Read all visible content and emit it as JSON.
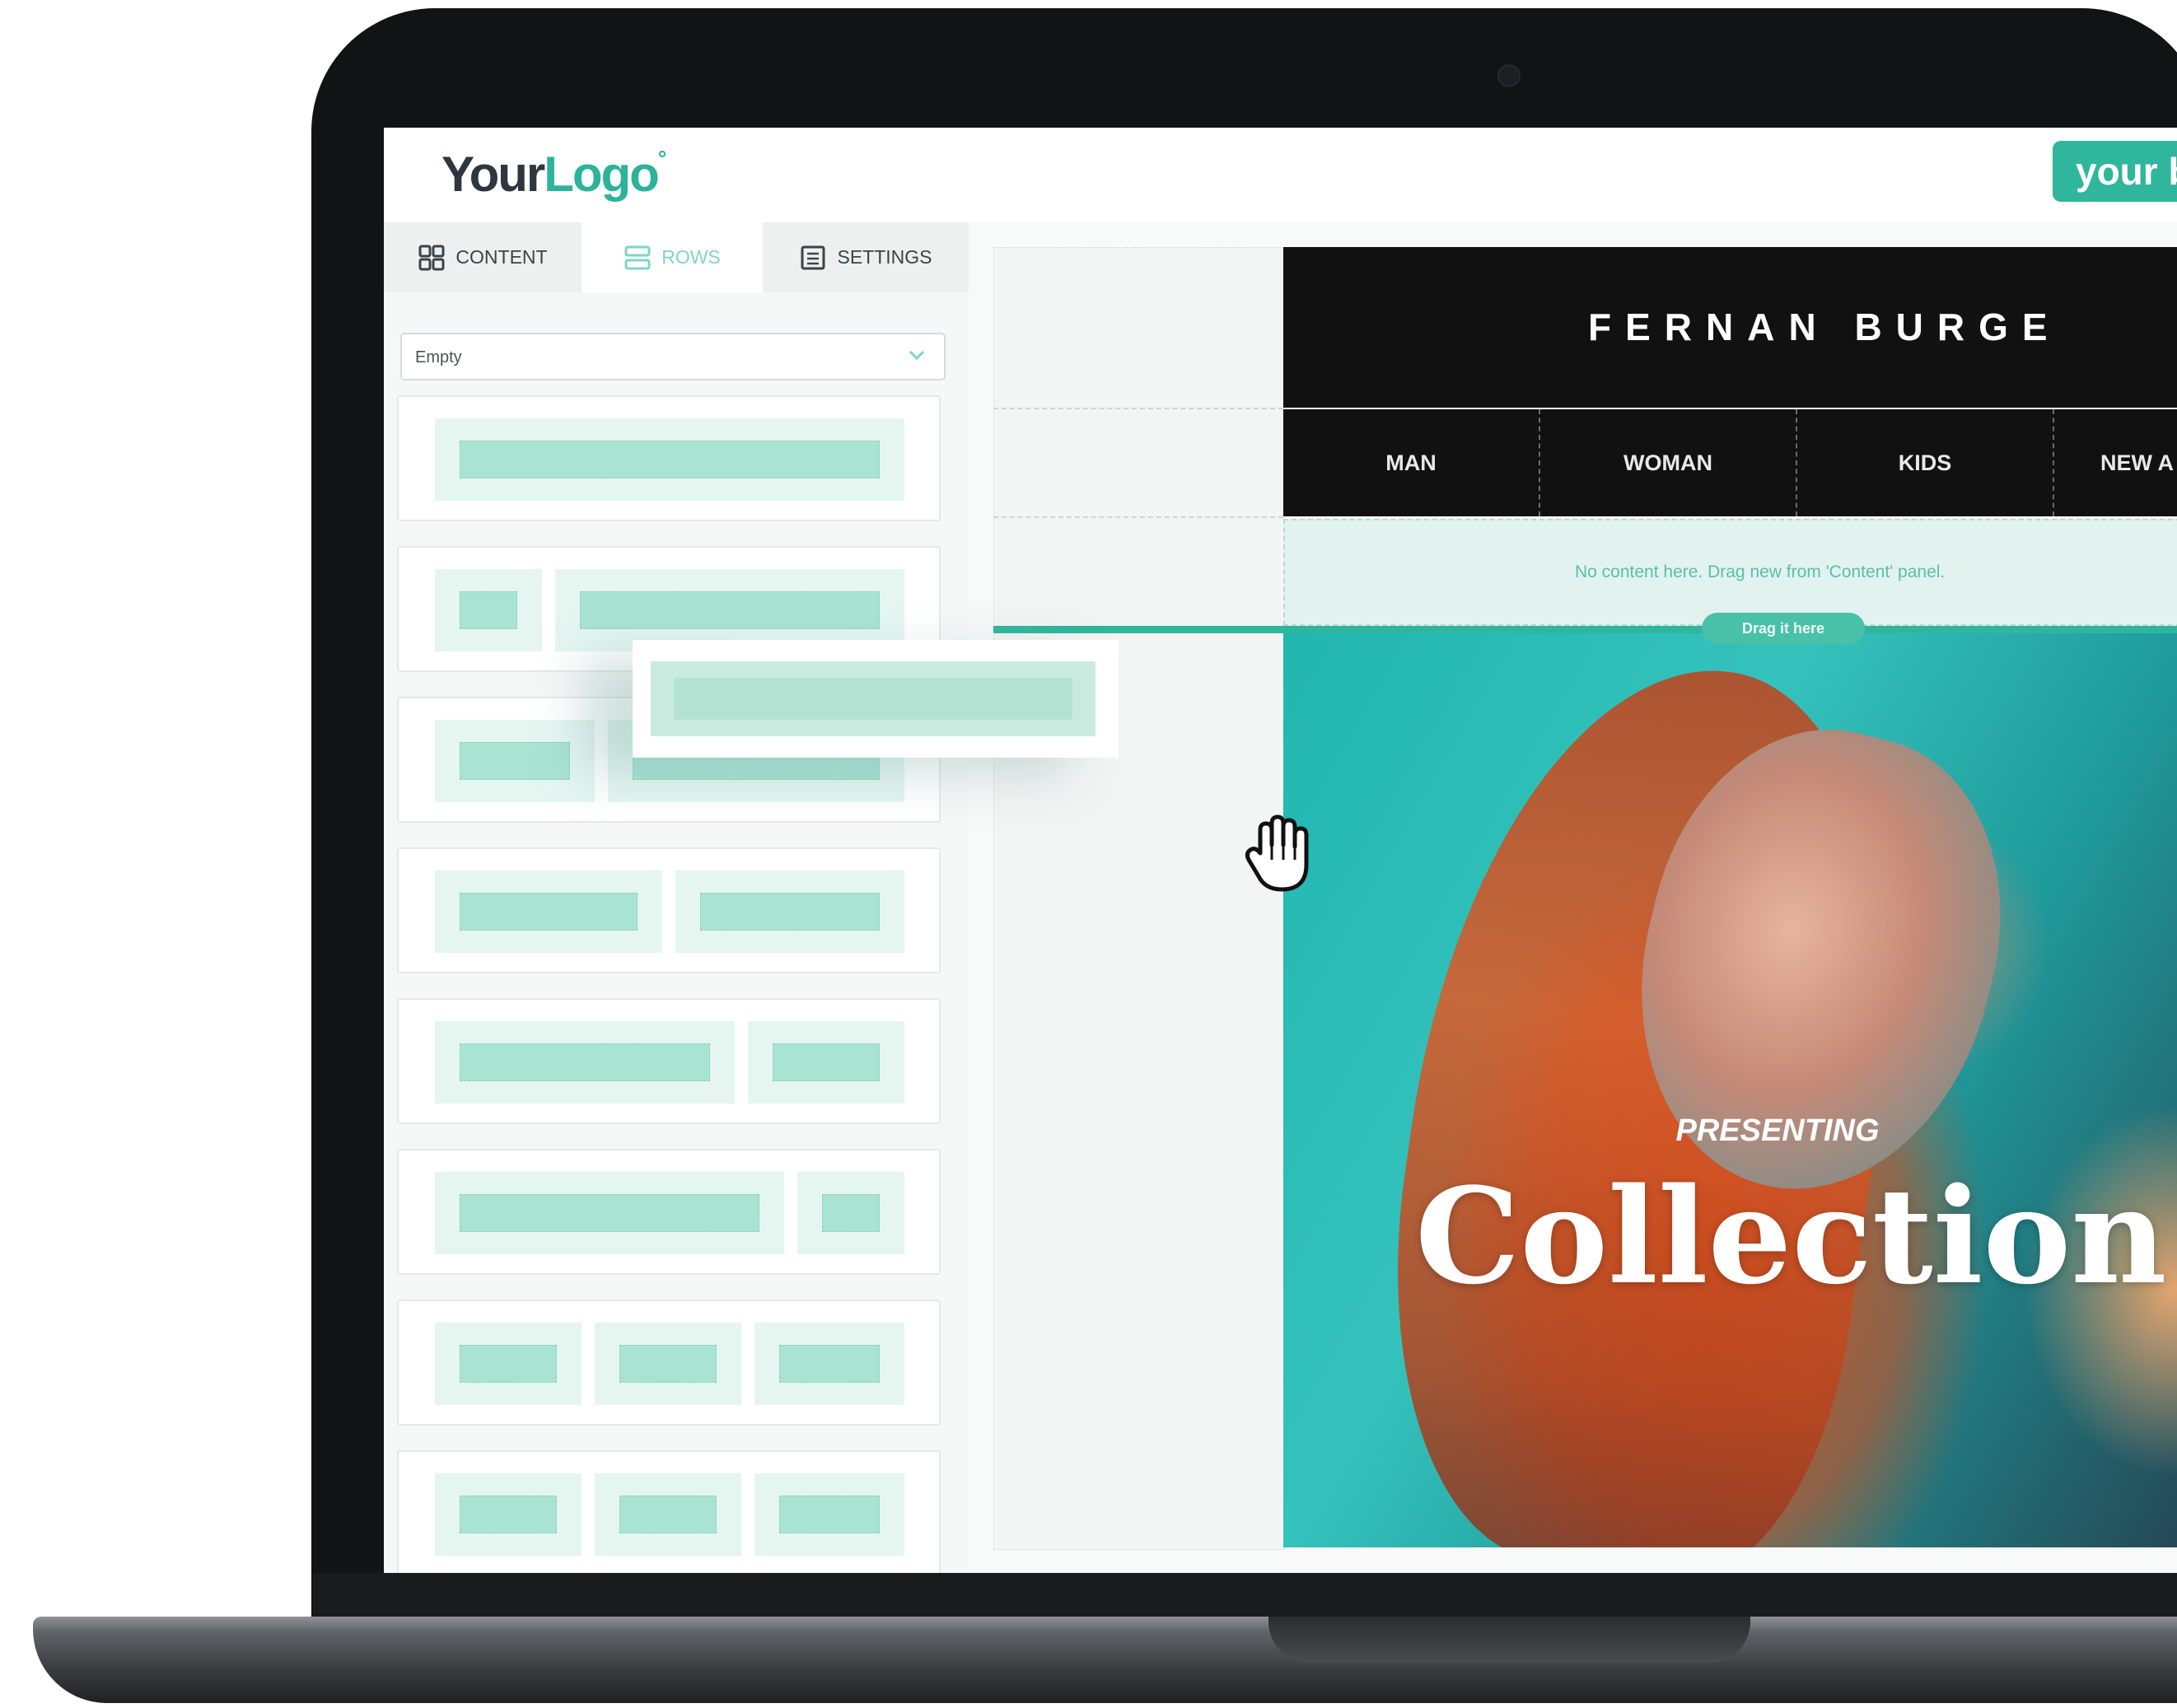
{
  "app": {
    "logo_your": "Your",
    "logo_logo": "Logo",
    "logo_mark": "°",
    "brand_button": "your b"
  },
  "sidebar": {
    "tabs": [
      {
        "label": "CONTENT",
        "icon": "grid-icon",
        "active": false
      },
      {
        "label": "ROWS",
        "icon": "rows-icon",
        "active": true
      },
      {
        "label": "SETTINGS",
        "icon": "settings-icon",
        "active": false
      }
    ],
    "select": {
      "value": "Empty"
    },
    "row_layouts": [
      {
        "columns": 1
      },
      {
        "columns": 2,
        "ratio": "1:3"
      },
      {
        "columns": 2,
        "ratio": "1:2"
      },
      {
        "columns": 2,
        "ratio": "1:1"
      },
      {
        "columns": 2,
        "ratio": "2:1"
      },
      {
        "columns": 2,
        "ratio": "3:1"
      },
      {
        "columns": 3,
        "ratio": "1:1:1"
      },
      {
        "columns": 3,
        "ratio": "1:1:1"
      }
    ]
  },
  "email": {
    "brand": "FERNAN BURGE",
    "nav": [
      "MAN",
      "WOMAN",
      "KIDS",
      "NEW A"
    ],
    "empty_message": "No content here. Drag new from 'Content' panel.",
    "drop_label": "Drag it here",
    "hero_kicker": "PRESENTING",
    "hero_title": "Collection X"
  },
  "colors": {
    "accent": "#2fb69c",
    "row_fill": "#a9e3d1",
    "header_bg": "#111111"
  }
}
